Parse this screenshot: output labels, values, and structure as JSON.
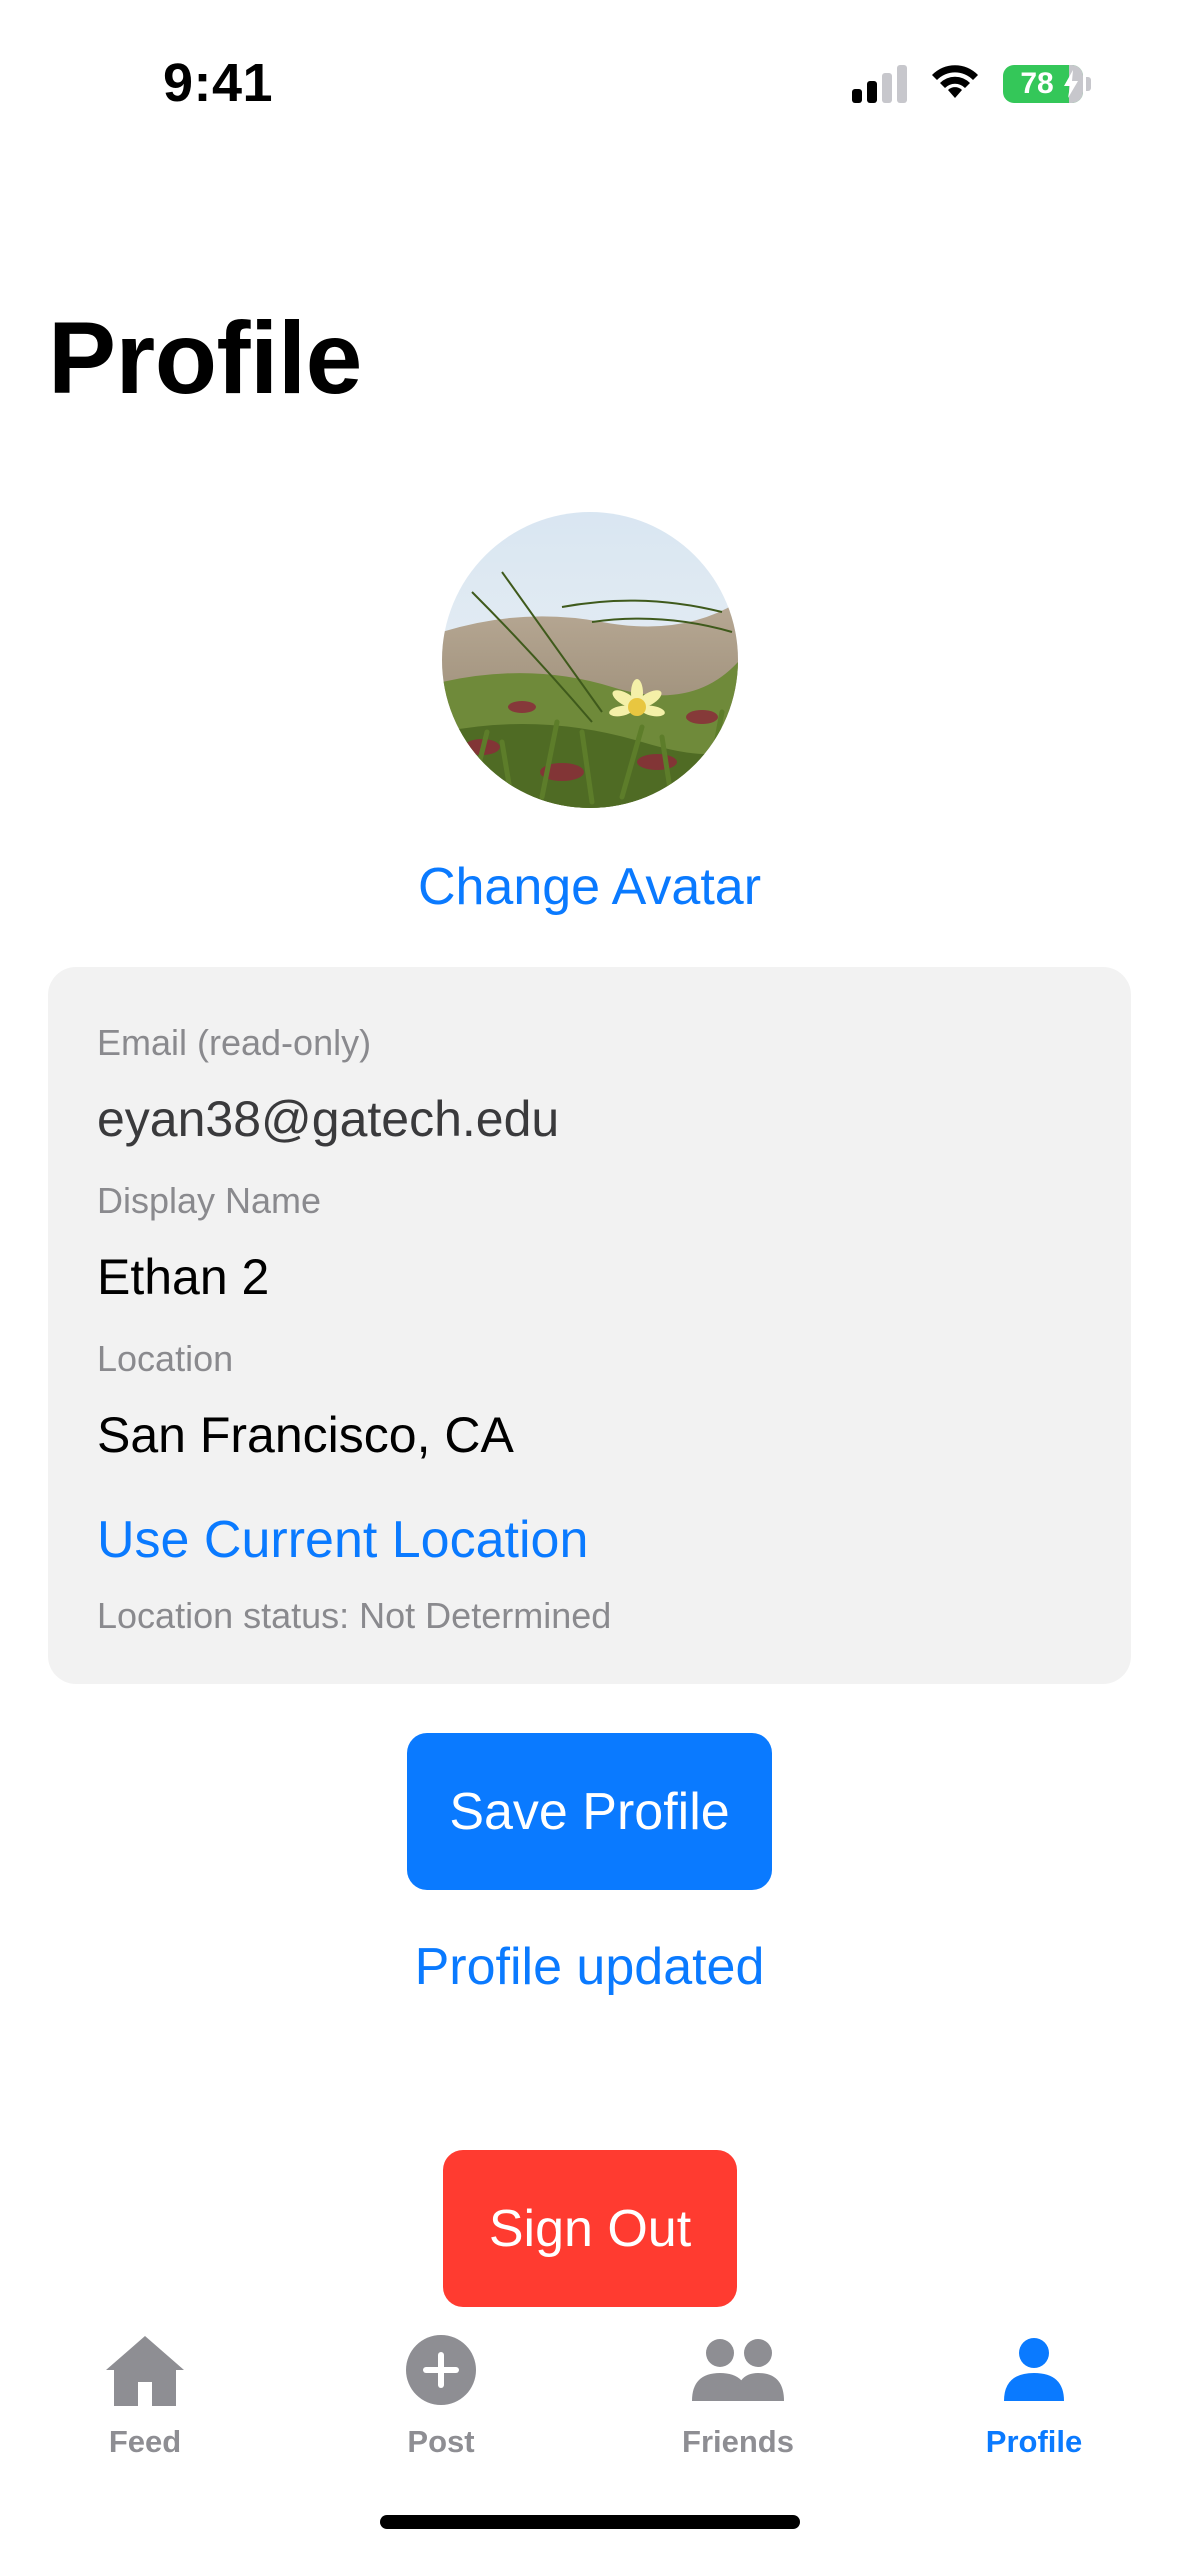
{
  "status_bar": {
    "time": "9:41",
    "battery_level": "78"
  },
  "page": {
    "title": "Profile"
  },
  "avatar": {
    "change_label": "Change Avatar"
  },
  "form": {
    "email_label": "Email (read-only)",
    "email_value": "eyan38@gatech.edu",
    "display_name_label": "Display Name",
    "display_name_value": "Ethan 2",
    "location_label": "Location",
    "location_value": "San Francisco, CA",
    "use_location_label": "Use Current Location",
    "location_status": "Location status: Not Determined"
  },
  "actions": {
    "save_label": "Save Profile",
    "save_status": "Profile updated",
    "sign_out_label": "Sign Out"
  },
  "tabbar": {
    "tabs": [
      {
        "label": "Feed",
        "icon": "house-icon"
      },
      {
        "label": "Post",
        "icon": "plus-circle-icon"
      },
      {
        "label": "Friends",
        "icon": "people-icon"
      },
      {
        "label": "Profile",
        "icon": "person-icon"
      }
    ],
    "active_tab": "Profile"
  },
  "colors": {
    "accent": "#0a7aff",
    "destructive": "#ff3b30",
    "battery": "#34c759",
    "card_bg": "#f2f2f2",
    "inactive_tab": "#8e8e93"
  }
}
